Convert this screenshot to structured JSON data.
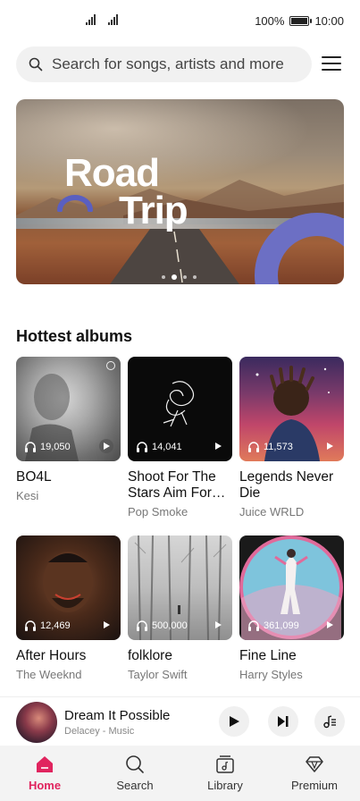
{
  "status_bar": {
    "battery": "100%",
    "time": "10:00"
  },
  "search": {
    "placeholder": "Search for songs, artists and more"
  },
  "banner": {
    "line1": "Road",
    "line2": "Trip",
    "active_dot": 2,
    "dot_count": 4
  },
  "hottest": {
    "title": "Hottest albums",
    "albums": [
      {
        "title": "BO4L",
        "artist": "Kesi",
        "plays": "19,050"
      },
      {
        "title": "Shoot For The Stars Aim For The Moon",
        "artist": "Pop Smoke",
        "plays": "14,041"
      },
      {
        "title": "Legends Never Die",
        "artist": "Juice WRLD",
        "plays": "11,573"
      },
      {
        "title": "After Hours",
        "artist": "The Weeknd",
        "plays": "12,469"
      },
      {
        "title": "folklore",
        "artist": "Taylor Swift",
        "plays": "500,000"
      },
      {
        "title": "Fine Line",
        "artist": "Harry Styles",
        "plays": "361,099"
      }
    ]
  },
  "now_playing": {
    "title": "Dream It Possible",
    "subtitle": "Delacey - Music"
  },
  "nav": {
    "home": "Home",
    "search": "Search",
    "library": "Library",
    "premium": "Premium"
  },
  "colors": {
    "accent": "#e0245e",
    "banner_ring": "#6c6fc4"
  }
}
